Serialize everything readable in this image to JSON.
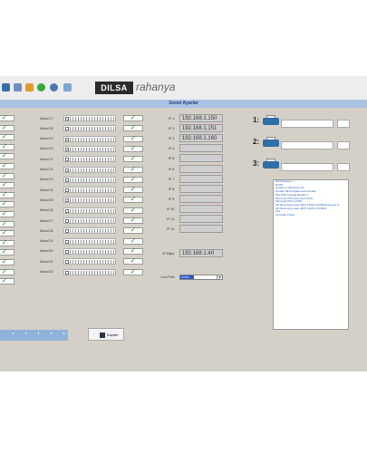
{
  "toolbar": {
    "logo_text": "DILSA",
    "logo2_text": "rahanya"
  },
  "title": "Genel Ayarlar",
  "left_checks": 18,
  "moduls": [
    "Modul 17",
    "Modul 18",
    "Modul 19",
    "Modul 20",
    "Modul 21",
    "Modul 22",
    "Modul 23",
    "Modul 24",
    "Modul 25",
    "Modul 26",
    "Modul 27",
    "Modul 28",
    "Modul 29",
    "Modul 30",
    "Modul 31",
    "Modul 32"
  ],
  "ip_rows": [
    {
      "label": "IP 1:",
      "value": "192.168.1.150"
    },
    {
      "label": "IP 2:",
      "value": "192.168.1.151"
    },
    {
      "label": "IP 3:",
      "value": "192.168.1.160"
    },
    {
      "label": "IP 4:",
      "value": ""
    },
    {
      "label": "IP 5:",
      "value": ""
    },
    {
      "label": "IP 6:",
      "value": ""
    },
    {
      "label": "IP 7:",
      "value": ""
    },
    {
      "label": "IP 8:",
      "value": ""
    },
    {
      "label": "IP 9:",
      "value": ""
    },
    {
      "label": "IP 10:",
      "value": ""
    },
    {
      "label": "IP 11:",
      "value": ""
    },
    {
      "label": "IP 12:",
      "value": ""
    }
  ],
  "ip_other": {
    "label": "IP Diğer:",
    "value": "192.168.1.40"
  },
  "com_port": {
    "label": "Com Port:",
    "value": "COM1"
  },
  "printers": [
    "1:",
    "2:",
    "3:"
  ],
  "printer_list": [
    "OPOS Kasa Y",
    "IP  MS",
    "Gonder to Windows 7E",
    "Gonder 2E Kongalomeral Lendan",
    "Mxx PDF Kyaska Murabl 3",
    "Microsoft XPS Document Write",
    "Microsoft Print to PDF",
    "HP Neverstop Laser MFP 1200w (PCR1E) (Kopya 1)",
    "HP Neverstop Laser MFP 1200w (PCR1E)",
    "Fax",
    "OneNote Printer"
  ],
  "save_label": "Kaydet"
}
